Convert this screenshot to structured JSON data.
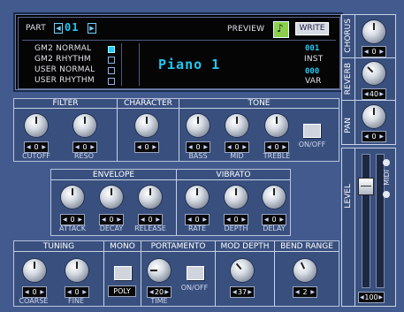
{
  "display": {
    "part_label": "PART",
    "part_value": "01",
    "preview_label": "PREVIEW",
    "write_label": "WRITE",
    "modes": [
      "GM2 NORMAL",
      "GM2  RHYTHM",
      "USER NORMAL",
      "USER RHYTHM"
    ],
    "selected_mode_index": 0,
    "patch_name": "Piano 1",
    "inst_value": "001",
    "inst_label": "INST",
    "var_value": "000",
    "var_label": "VAR"
  },
  "effects": {
    "chorus_label": "CHORUS",
    "chorus_value": "0",
    "reverb_label": "REVERB",
    "reverb_value": "40",
    "pan_label": "PAN",
    "pan_value": "0"
  },
  "level": {
    "label": "LEVEL",
    "value": "100",
    "midi_label": "MIDI"
  },
  "filter": {
    "title": "FILTER",
    "cutoff": {
      "label": "CUTOFF",
      "value": "0"
    },
    "reso": {
      "label": "RESO",
      "value": "0"
    }
  },
  "character": {
    "title": "CHARACTER",
    "value": "0"
  },
  "tone": {
    "title": "TONE",
    "bass": {
      "label": "BASS",
      "value": "0"
    },
    "mid": {
      "label": "MID",
      "value": "0"
    },
    "treble": {
      "label": "TREBLE",
      "value": "0"
    },
    "onoff_label": "ON/OFF"
  },
  "envelope": {
    "title": "ENVELOPE",
    "attack": {
      "label": "ATTACK",
      "value": "0"
    },
    "decay": {
      "label": "DECAY",
      "value": "0"
    },
    "release": {
      "label": "RELEASE",
      "value": "0"
    }
  },
  "vibrato": {
    "title": "VIBRATO",
    "rate": {
      "label": "RATE",
      "value": "0"
    },
    "depth": {
      "label": "DEPTH",
      "value": "0"
    },
    "delay": {
      "label": "DELAY",
      "value": "0"
    }
  },
  "tuning": {
    "title": "TUNING",
    "coarse": {
      "label": "COARSE",
      "value": "0"
    },
    "fine": {
      "label": "FINE",
      "value": "0"
    }
  },
  "mono": {
    "title": "MONO",
    "poly_label": "POLY"
  },
  "portamento": {
    "title": "PORTAMENTO",
    "time": {
      "label": "TIME",
      "value": "20"
    },
    "onoff_label": "ON/OFF"
  },
  "mod_depth": {
    "title": "MOD DEPTH",
    "value": "37"
  },
  "bend_range": {
    "title": "BEND RANGE",
    "value": "2"
  }
}
